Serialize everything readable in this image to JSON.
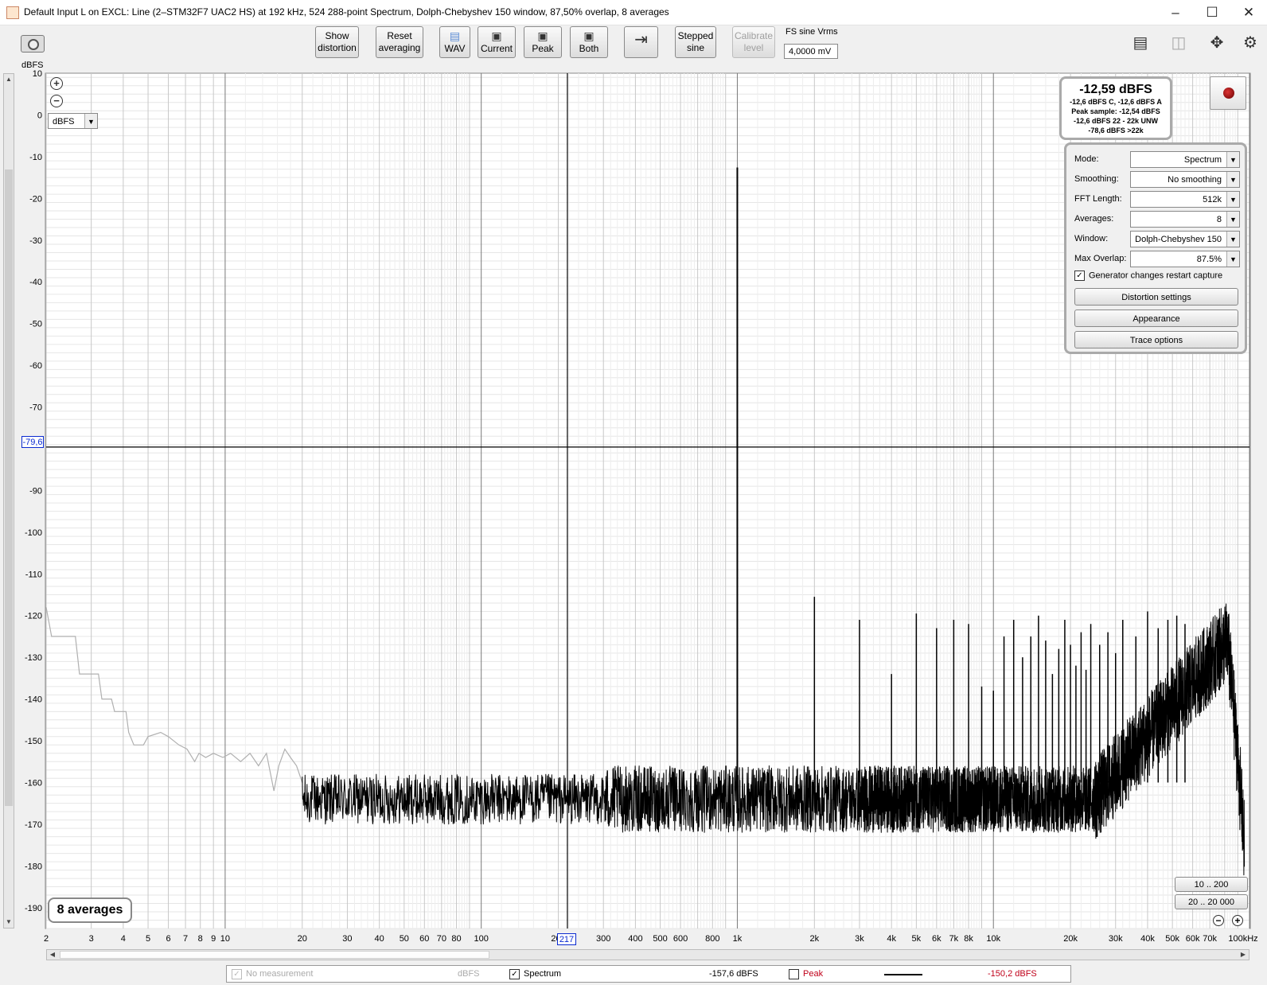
{
  "window": {
    "title": "Default Input L on EXCL: Line (2–STM32F7 UAC2 HS) at 192 kHz, 524 288-point Spectrum, Dolph-Chebyshev 150 window, 87,50% overlap, 8 averages",
    "minimize": "–",
    "maximize": "☐",
    "close": "✕"
  },
  "toolbar": {
    "show_distortion": [
      "Show",
      "distortion"
    ],
    "reset_averaging": [
      "Reset",
      "averaging"
    ],
    "wav": "WAV",
    "current": "Current",
    "peak": "Peak",
    "both": "Both",
    "stepped_sine": [
      "Stepped",
      "sine"
    ],
    "calibrate_level": [
      "Calibrate",
      "level"
    ],
    "fs_sine_label": "FS sine Vrms",
    "fs_sine_value": "4,0000 mV"
  },
  "plot": {
    "y_unit_label": "dBFS",
    "unit_select": "dBFS",
    "cursor_y_value": "-79,6",
    "cursor_x_value": "217",
    "averages_badge": "8 averages"
  },
  "readout": {
    "main": "-12,59 dBFS",
    "line1": "-12,6 dBFS C, -12,6 dBFS A",
    "line2": "Peak sample: -12,54 dBFS",
    "line3": "-12,6 dBFS 22 - 22k UNW",
    "line4": "-78,6 dBFS >22k"
  },
  "panel": {
    "mode_label": "Mode:",
    "mode_value": "Spectrum",
    "smoothing_label": "Smoothing:",
    "smoothing_value": "No  smoothing",
    "fft_label": "FFT Length:",
    "fft_value": "512k",
    "averages_label": "Averages:",
    "averages_value": "8",
    "window_label": "Window:",
    "window_value": "Dolph-Chebyshev 150",
    "overlap_label": "Max Overlap:",
    "overlap_value": "87.5%",
    "restart_label": "Generator changes restart capture",
    "distortion_btn": "Distortion settings",
    "appearance_btn": "Appearance",
    "trace_btn": "Trace options"
  },
  "range_buttons": {
    "r1": "10 .. 200",
    "r2": "20 .. 20 000"
  },
  "legend": {
    "no_measurement": "No measurement",
    "no_measurement_unit": "dBFS",
    "spectrum": "Spectrum",
    "spectrum_value": "-157,6 dBFS",
    "peak": "Peak",
    "peak_value": "-150,2 dBFS",
    "peak_color": "#c0001a"
  },
  "chart_data": {
    "type": "line",
    "x_scale": "log",
    "xlim": [
      2,
      100000
    ],
    "ylim": [
      -195,
      10
    ],
    "ylabel": "dBFS",
    "y_ticks": [
      10,
      0,
      -10,
      -20,
      -30,
      -40,
      -50,
      -60,
      -70,
      -90,
      -100,
      -110,
      -120,
      -130,
      -140,
      -150,
      -160,
      -170,
      -180,
      -190
    ],
    "x_ticks": [
      {
        "v": 2,
        "l": "2"
      },
      {
        "v": 3,
        "l": "3"
      },
      {
        "v": 4,
        "l": "4"
      },
      {
        "v": 5,
        "l": "5"
      },
      {
        "v": 6,
        "l": "6"
      },
      {
        "v": 7,
        "l": "7"
      },
      {
        "v": 8,
        "l": "8"
      },
      {
        "v": 9,
        "l": "9"
      },
      {
        "v": 10,
        "l": "10"
      },
      {
        "v": 20,
        "l": "20"
      },
      {
        "v": 30,
        "l": "30"
      },
      {
        "v": 40,
        "l": "40"
      },
      {
        "v": 50,
        "l": "50"
      },
      {
        "v": 60,
        "l": "60"
      },
      {
        "v": 70,
        "l": "70"
      },
      {
        "v": 80,
        "l": "80"
      },
      {
        "v": 100,
        "l": "100"
      },
      {
        "v": 200,
        "l": "200"
      },
      {
        "v": 300,
        "l": "300"
      },
      {
        "v": 400,
        "l": "400"
      },
      {
        "v": 500,
        "l": "500"
      },
      {
        "v": 600,
        "l": "600"
      },
      {
        "v": 800,
        "l": "800"
      },
      {
        "v": 1000,
        "l": "1k"
      },
      {
        "v": 2000,
        "l": "2k"
      },
      {
        "v": 3000,
        "l": "3k"
      },
      {
        "v": 4000,
        "l": "4k"
      },
      {
        "v": 5000,
        "l": "5k"
      },
      {
        "v": 6000,
        "l": "6k"
      },
      {
        "v": 7000,
        "l": "7k"
      },
      {
        "v": 8000,
        "l": "8k"
      },
      {
        "v": 10000,
        "l": "10k"
      },
      {
        "v": 20000,
        "l": "20k"
      },
      {
        "v": 30000,
        "l": "30k"
      },
      {
        "v": 40000,
        "l": "40k"
      },
      {
        "v": 50000,
        "l": "50k"
      },
      {
        "v": 60000,
        "l": "60k"
      },
      {
        "v": 70000,
        "l": "70k"
      },
      {
        "v": 100000,
        "l": "100kHz"
      }
    ],
    "cursor": {
      "x": 217,
      "y": -79.6
    },
    "grey_trace": [
      [
        2,
        -118
      ],
      [
        2.1,
        -125
      ],
      [
        2.6,
        -125
      ],
      [
        2.7,
        -134
      ],
      [
        3.2,
        -134
      ],
      [
        3.3,
        -140
      ],
      [
        3.6,
        -140
      ],
      [
        3.7,
        -143
      ],
      [
        4.1,
        -143
      ],
      [
        4.2,
        -148
      ],
      [
        4.4,
        -151
      ],
      [
        4.8,
        -151
      ],
      [
        5,
        -149
      ],
      [
        5.6,
        -148
      ],
      [
        6,
        -149
      ],
      [
        6.6,
        -151
      ],
      [
        7.1,
        -152
      ],
      [
        7.6,
        -155
      ],
      [
        7.9,
        -153
      ],
      [
        8.4,
        -154
      ],
      [
        9,
        -153
      ],
      [
        9.8,
        -154
      ],
      [
        10.5,
        -153
      ],
      [
        11.5,
        -155
      ],
      [
        12.5,
        -153
      ],
      [
        13.5,
        -156
      ],
      [
        14.5,
        -153
      ],
      [
        15.5,
        -162
      ],
      [
        16.2,
        -156
      ],
      [
        17.1,
        -152
      ],
      [
        18,
        -154
      ],
      [
        19,
        -156
      ],
      [
        20,
        -160
      ]
    ],
    "spectrum_floor_db": -160,
    "spectrum_peaks": [
      [
        1000,
        -12.6
      ],
      [
        2000,
        -115.5
      ],
      [
        3000,
        -121
      ],
      [
        4000,
        -134
      ],
      [
        5000,
        -119.5
      ],
      [
        6000,
        -123
      ],
      [
        7000,
        -121
      ],
      [
        8000,
        -122
      ],
      [
        9000,
        -137
      ],
      [
        10000,
        -138
      ],
      [
        11000,
        -125
      ],
      [
        12000,
        -121
      ],
      [
        13000,
        -130
      ],
      [
        14000,
        -125
      ],
      [
        15000,
        -120
      ],
      [
        16000,
        -126
      ],
      [
        17000,
        -134
      ],
      [
        18000,
        -128
      ],
      [
        19000,
        -121
      ],
      [
        20000,
        -127
      ],
      [
        21000,
        -132
      ],
      [
        22000,
        -124
      ],
      [
        23000,
        -133
      ],
      [
        24000,
        -122
      ],
      [
        26000,
        -127
      ],
      [
        28000,
        -124
      ],
      [
        30000,
        -129
      ],
      [
        32000,
        -121
      ],
      [
        36000,
        -125
      ],
      [
        40000,
        -119
      ],
      [
        44000,
        -123
      ],
      [
        48000,
        -121
      ],
      [
        52000,
        -120
      ],
      [
        56000,
        -122
      ]
    ],
    "legend_entries": [
      {
        "name": "Spectrum",
        "color": "#000000"
      },
      {
        "name": "Peak",
        "color": "#c0001a"
      }
    ]
  }
}
